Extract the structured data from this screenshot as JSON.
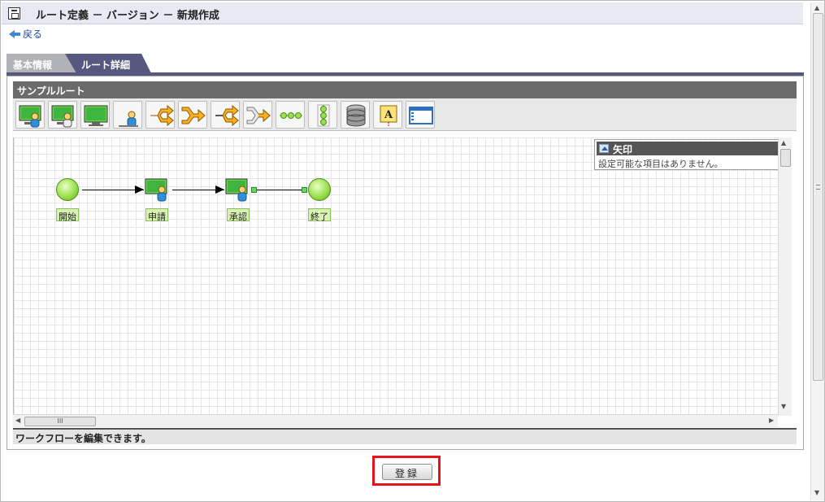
{
  "header": {
    "title": "ルート定義 － バージョン － 新規作成",
    "back_label": "戻る"
  },
  "tabs": [
    {
      "label": "基本情報",
      "active": false
    },
    {
      "label": "ルート詳細",
      "active": true
    }
  ],
  "panel": {
    "title": "サンプルルート",
    "status": "ワークフローを編集できます。"
  },
  "toolbar": {
    "tools": [
      {
        "name": "user-node-tool-icon"
      },
      {
        "name": "user-node-alt-tool-icon"
      },
      {
        "name": "screen-node-tool-icon"
      },
      {
        "name": "person-tool-icon"
      },
      {
        "name": "split-tool-icon"
      },
      {
        "name": "join-tool-icon"
      },
      {
        "name": "split-outline-tool-icon"
      },
      {
        "name": "join-outline-tool-icon"
      },
      {
        "name": "horizontal-chain-tool-icon"
      },
      {
        "name": "vertical-chain-tool-icon"
      },
      {
        "name": "database-tool-icon"
      },
      {
        "name": "text-annotation-tool-icon"
      },
      {
        "name": "window-tool-icon"
      }
    ]
  },
  "property_box": {
    "title": "矢印",
    "message": "設定可能な項目はありません。"
  },
  "flow": {
    "nodes": [
      {
        "label": "開始",
        "type": "start"
      },
      {
        "label": "申請",
        "type": "user"
      },
      {
        "label": "承認",
        "type": "user"
      },
      {
        "label": "終了",
        "type": "end"
      }
    ]
  },
  "scrollbar": {
    "thumb_label": "III"
  },
  "register_button": {
    "label": "登録"
  },
  "colors": {
    "accent": "#56587f",
    "highlight": "#e8121a",
    "node_green": "#9be04f"
  }
}
